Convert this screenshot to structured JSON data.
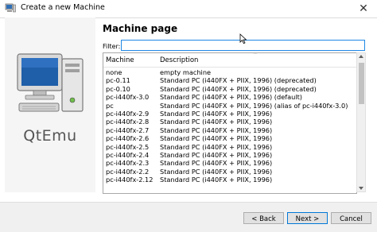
{
  "window": {
    "title": "Create a new Machine",
    "close_glyph": "✕"
  },
  "side": {
    "app_name": "QtEmu",
    "illustration": "computer-monitor-tower-icon"
  },
  "page": {
    "title": "Machine page",
    "filter_label": "Filter:",
    "filter_value": ""
  },
  "table": {
    "columns": [
      "Machine",
      "Description"
    ],
    "rows": [
      {
        "machine": "none",
        "description": "empty machine"
      },
      {
        "machine": "pc-0.11",
        "description": "Standard PC (i440FX + PIIX, 1996) (deprecated)"
      },
      {
        "machine": "pc-0.10",
        "description": "Standard PC (i440FX + PIIX, 1996) (deprecated)"
      },
      {
        "machine": "pc-i440fx-3.0",
        "description": "Standard PC (i440FX + PIIX, 1996) (default)"
      },
      {
        "machine": "pc",
        "description": "Standard PC (i440FX + PIIX, 1996) (alias of pc-i440fx-3.0)"
      },
      {
        "machine": "pc-i440fx-2.9",
        "description": "Standard PC (i440FX + PIIX, 1996)"
      },
      {
        "machine": "pc-i440fx-2.8",
        "description": "Standard PC (i440FX + PIIX, 1996)"
      },
      {
        "machine": "pc-i440fx-2.7",
        "description": "Standard PC (i440FX + PIIX, 1996)"
      },
      {
        "machine": "pc-i440fx-2.6",
        "description": "Standard PC (i440FX + PIIX, 1996)"
      },
      {
        "machine": "pc-i440fx-2.5",
        "description": "Standard PC (i440FX + PIIX, 1996)"
      },
      {
        "machine": "pc-i440fx-2.4",
        "description": "Standard PC (i440FX + PIIX, 1996)"
      },
      {
        "machine": "pc-i440fx-2.3",
        "description": "Standard PC (i440FX + PIIX, 1996)"
      },
      {
        "machine": "pc-i440fx-2.2",
        "description": "Standard PC (i440FX + PIIX, 1996)"
      },
      {
        "machine": "pc-i440fx-2.12",
        "description": "Standard PC (i440FX + PIIX, 1996)"
      }
    ]
  },
  "buttons": {
    "back": "< Back",
    "next": "Next >",
    "cancel": "Cancel"
  },
  "colors": {
    "accent": "#0078d7",
    "filter_border": "#1e88e5"
  }
}
